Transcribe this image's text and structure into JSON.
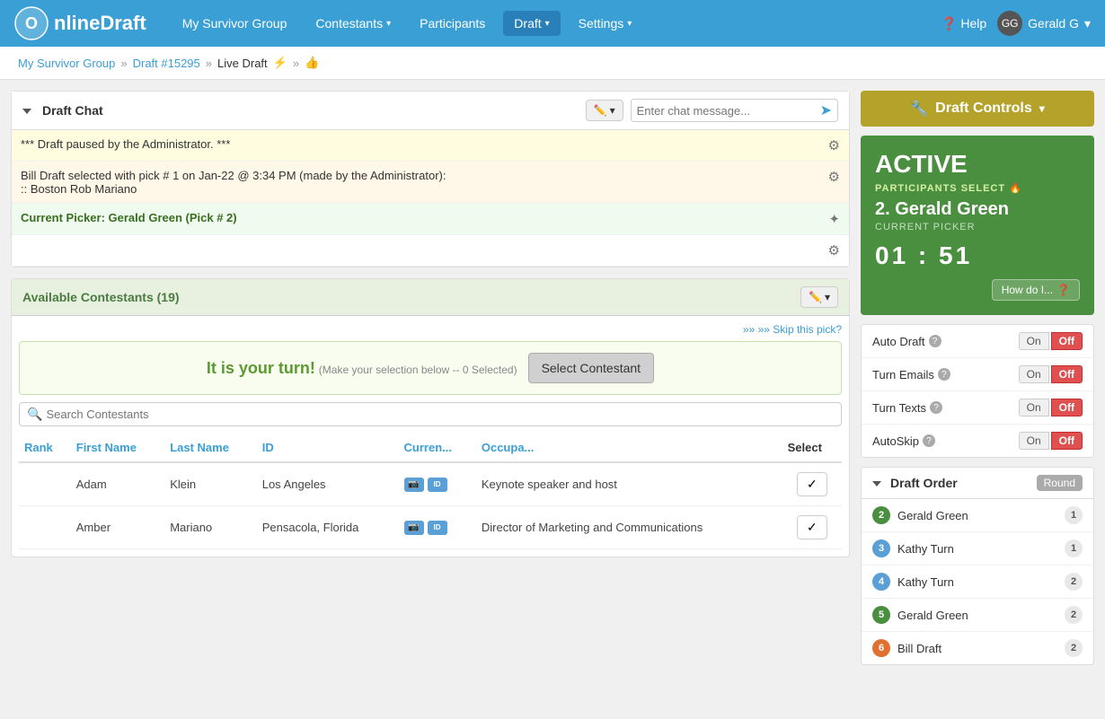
{
  "nav": {
    "brand": "nlineDraft",
    "links": [
      {
        "label": "My Survivor Group",
        "active": false
      },
      {
        "label": "Contestants",
        "active": false,
        "dropdown": true
      },
      {
        "label": "Participants",
        "active": false
      },
      {
        "label": "Draft",
        "active": true,
        "dropdown": true
      },
      {
        "label": "Settings",
        "active": false,
        "dropdown": true
      }
    ],
    "help_label": "Help",
    "user_label": "Gerald G"
  },
  "breadcrumb": {
    "home": "My Survivor Group",
    "draft": "Draft #15295",
    "current": "Live Draft"
  },
  "chat": {
    "title": "Draft Chat",
    "placeholder": "Enter chat message...",
    "messages": [
      {
        "text": "*** Draft paused by the Administrator. ***",
        "type": "warning"
      },
      {
        "text": "Bill Draft selected with pick # 1 on Jan-22 @ 3:34 PM (made by the Administrator):\n:: Boston Rob Mariano",
        "type": "info"
      },
      {
        "text": "Current Picker: Gerald Green (Pick # 2)",
        "type": "success"
      }
    ]
  },
  "contestants": {
    "title": "Available Contestants (19)",
    "skip_label": "»» Skip this pick?",
    "your_turn": "It is your turn!",
    "your_turn_sub": "(Make your selection below -- 0 Selected)",
    "select_btn": "Select Contestant",
    "search_placeholder": "Search Contestants",
    "columns": [
      "Rank",
      "First Name",
      "Last Name",
      "ID",
      "Curren...",
      "Occupa...",
      "Select"
    ],
    "rows": [
      {
        "rank": "",
        "first": "Adam",
        "last": "Klein",
        "id": "Los Angeles",
        "current": "",
        "occupation": "Keynote speaker and host",
        "select": "✓"
      },
      {
        "rank": "",
        "first": "Amber",
        "last": "Mariano",
        "id": "Pensacola, Florida",
        "current": "",
        "occupation": "Director of Marketing and Communications",
        "select": "✓"
      }
    ]
  },
  "draft_controls": {
    "button_label": "Draft Controls",
    "status": "ACTIVE",
    "participants_select": "PARTICIPANTS SELECT",
    "current_picker_num": "2.",
    "current_picker": "Gerald Green",
    "current_picker_label": "CURRENT PICKER",
    "timer": "01 : 51",
    "how_do_label": "How do I...",
    "toggles": [
      {
        "label": "Auto Draft",
        "name": "auto-draft",
        "state": "off"
      },
      {
        "label": "Turn Emails",
        "name": "turn-emails",
        "state": "off"
      },
      {
        "label": "Turn Texts",
        "name": "turn-texts",
        "state": "off"
      },
      {
        "label": "AutoSkip",
        "name": "autoskip",
        "state": "off"
      }
    ],
    "draft_order": {
      "title": "Draft Order",
      "round_label": "Round",
      "items": [
        {
          "num": "2",
          "name": "Gerald Green",
          "round": "1",
          "color": "green"
        },
        {
          "num": "3",
          "name": "Kathy Turn",
          "round": "1",
          "color": "blue"
        },
        {
          "num": "4",
          "name": "Kathy Turn",
          "round": "2",
          "color": "blue"
        },
        {
          "num": "5",
          "name": "Gerald Green",
          "round": "2",
          "color": "green"
        },
        {
          "num": "6",
          "name": "Bill Draft",
          "round": "2",
          "color": "orange"
        }
      ]
    }
  }
}
